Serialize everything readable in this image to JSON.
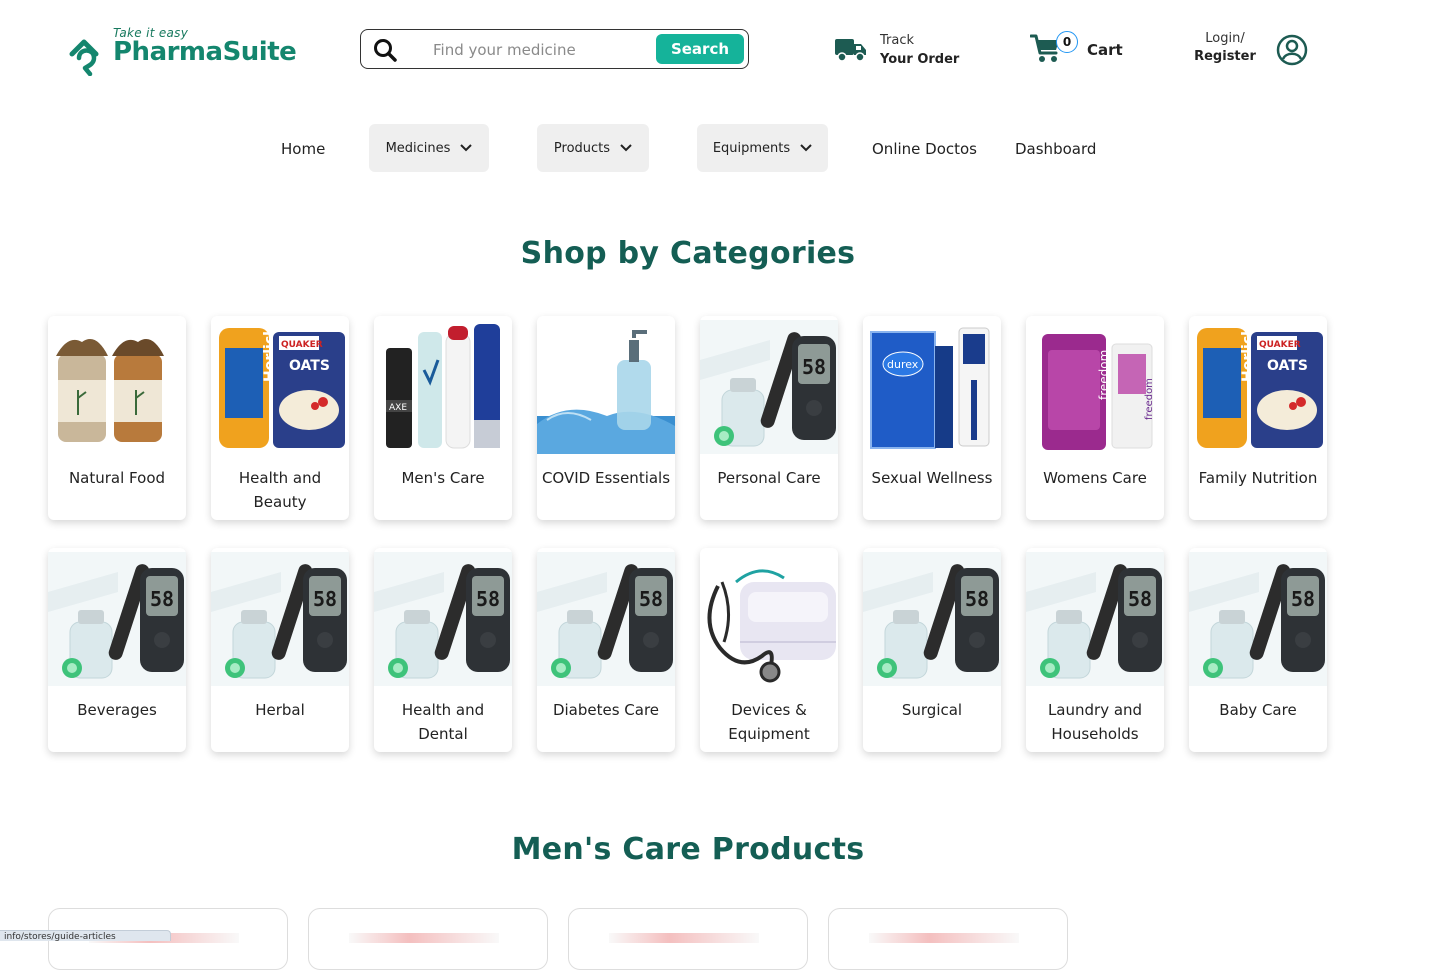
{
  "header": {
    "tagline": "Take it easy",
    "brand": "PharmaSuite",
    "search_placeholder": "Find your medicine",
    "search_button": "Search",
    "track_line1": "Track",
    "track_line2": "Your Order",
    "cart_count": "0",
    "cart_label": "Cart",
    "login_line1": "Login/",
    "login_line2": "Register"
  },
  "nav": {
    "home": "Home",
    "medicines": "Medicines",
    "products": "Products",
    "equipments": "Equipments",
    "online_doctors": "Online Doctos",
    "dashboard": "Dashboard"
  },
  "categories_title": "Shop by Categories",
  "categories": [
    {
      "name": "Natural Food",
      "image": "natural-food"
    },
    {
      "name": "Health and Beauty",
      "image": "nutrition"
    },
    {
      "name": "Men's Care",
      "image": "mens-care"
    },
    {
      "name": "COVID Essentials",
      "image": "covid"
    },
    {
      "name": "Personal Care",
      "image": "glucometer"
    },
    {
      "name": "Sexual Wellness",
      "image": "wellness"
    },
    {
      "name": "Womens Care",
      "image": "womens-care"
    },
    {
      "name": "Family Nutrition",
      "image": "nutrition"
    },
    {
      "name": "Beverages",
      "image": "glucometer"
    },
    {
      "name": "Herbal",
      "image": "glucometer"
    },
    {
      "name": "Health and Dental",
      "image": "glucometer"
    },
    {
      "name": "Diabetes Care",
      "image": "glucometer"
    },
    {
      "name": "Devices & Equipment",
      "image": "stethoscope"
    },
    {
      "name": "Surgical",
      "image": "glucometer"
    },
    {
      "name": "Laundry and Households",
      "image": "glucometer"
    },
    {
      "name": "Baby Care",
      "image": "glucometer"
    }
  ],
  "mens_care_title": "Men's Care Products",
  "status_bar_url": "info/stores/guide-articles",
  "colors": {
    "brand": "#14866e",
    "accent": "#15b39a",
    "heading": "#145e54"
  }
}
